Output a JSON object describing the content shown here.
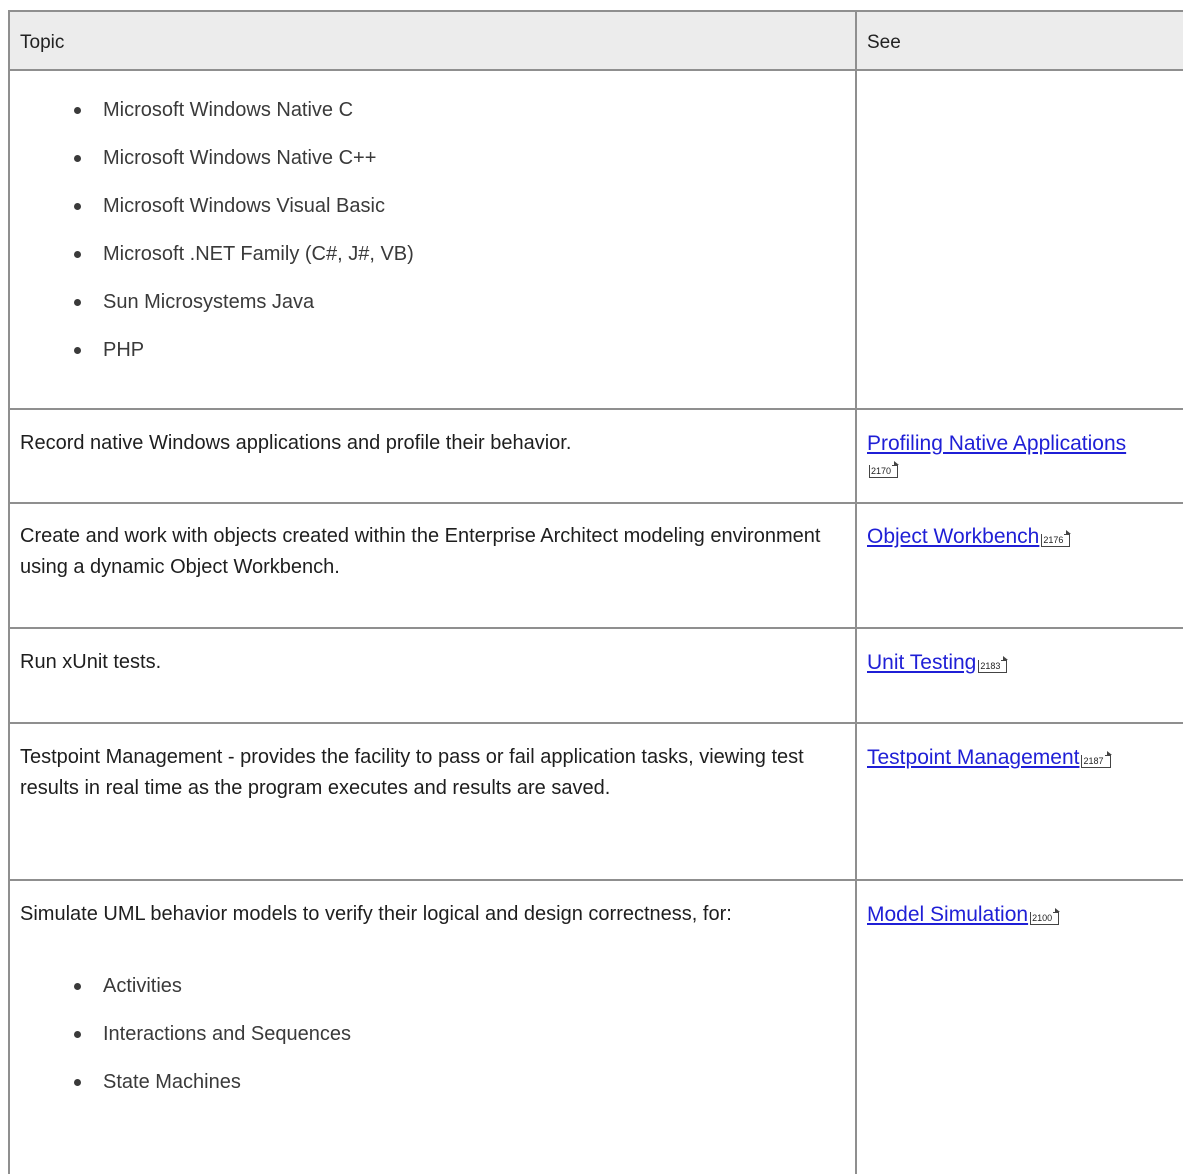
{
  "header": {
    "topic_label": "Topic",
    "see_label": "See"
  },
  "rows": [
    {
      "topic": "",
      "bullets": [
        "Microsoft Windows Native C",
        "Microsoft Windows Native C++",
        "Microsoft Windows Visual Basic",
        "Microsoft .NET Family (C#, J#, VB)",
        "Sun Microsystems Java",
        "PHP"
      ],
      "see": null
    },
    {
      "topic": "Record native Windows applications and profile their behavior.",
      "see": {
        "link": "Profiling Native Applications",
        "page": "2170"
      }
    },
    {
      "topic": "Create and work with objects created within the Enterprise Architect modeling environment using a dynamic Object Workbench.",
      "see": {
        "link": "Object Workbench",
        "page": "2176"
      }
    },
    {
      "topic": "Run xUnit tests.",
      "see": {
        "link": "Unit Testing",
        "page": "2183"
      }
    },
    {
      "topic": "Testpoint Management - provides the facility to pass or fail application tasks, viewing test results in real time as the program executes and results are saved.",
      "see": {
        "link": "Testpoint Management",
        "page": "2187"
      }
    },
    {
      "topic": "Simulate UML behavior models  to verify their logical and design correctness, for:",
      "bullets": [
        "Activities",
        "Interactions and Sequences",
        "State Machines"
      ],
      "see": {
        "link": "Model Simulation",
        "page": "2100"
      }
    }
  ]
}
